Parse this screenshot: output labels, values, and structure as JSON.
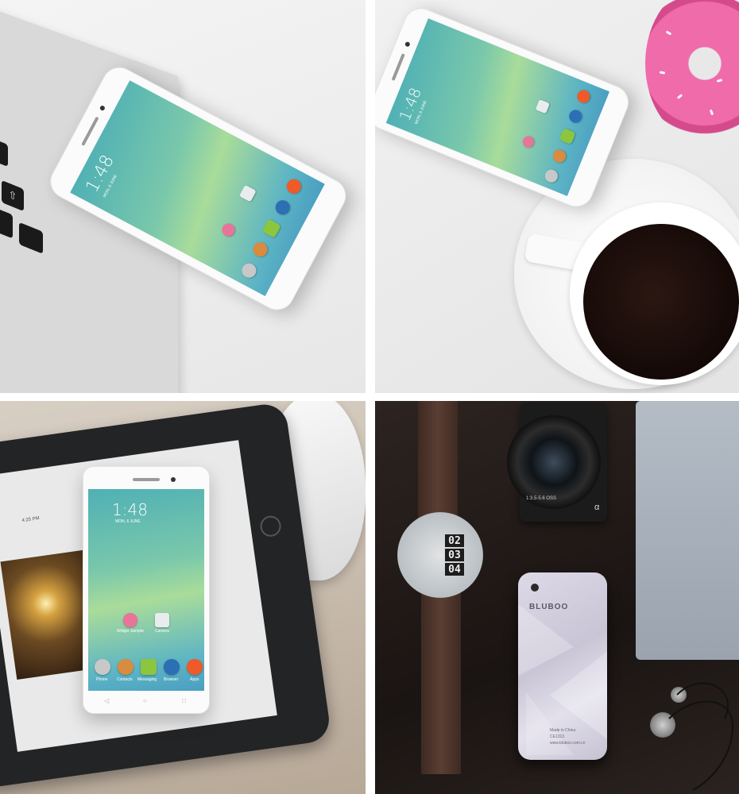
{
  "phone_screen": {
    "time": "1:48",
    "date": "MON, 6 JUNE",
    "apps": {
      "widget": "Widget Sample",
      "camera": "Camera",
      "phone": "Phone",
      "contacts": "Contacts",
      "messaging": "Messaging",
      "browser": "Browser",
      "apps": "Apps"
    }
  },
  "keyboard_arrow": "⇧",
  "phone_back": {
    "brand": "BLUBOO",
    "made_in": "Made in China",
    "model_code": "CE1313",
    "website": "www.bluboo.com.cn"
  },
  "camera_text": {
    "lens_marking": "1:3.5-5.6 OSS",
    "brand_mark": "α"
  },
  "tablet_text": {
    "time": "4:25 PM"
  },
  "watch_digits": [
    "02",
    "03",
    "04"
  ],
  "colors": {
    "screen_accent": "#7ac8ab",
    "donut_pink": "#f06ba9",
    "coffee": "#120806"
  }
}
